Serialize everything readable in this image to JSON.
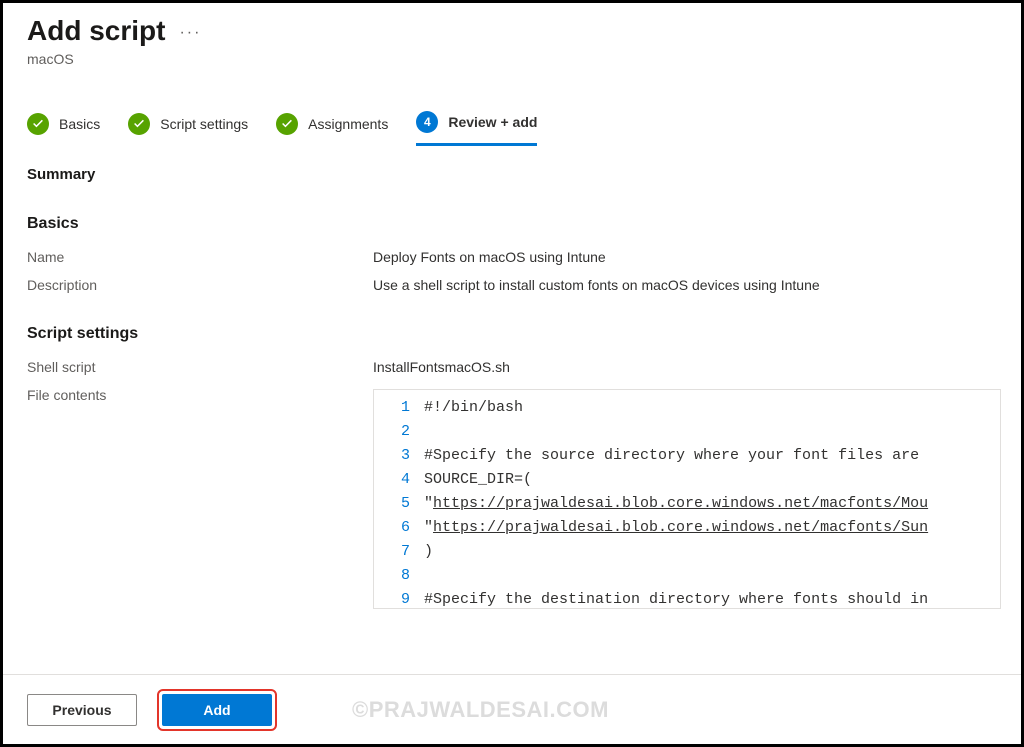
{
  "header": {
    "title": "Add script",
    "subtitle": "macOS",
    "ellipsis": "···"
  },
  "tabs": [
    {
      "label": "Basics",
      "done": true
    },
    {
      "label": "Script settings",
      "done": true
    },
    {
      "label": "Assignments",
      "done": true
    },
    {
      "label": "Review + add",
      "number": "4",
      "active": true
    }
  ],
  "summary_label": "Summary",
  "sections": {
    "basics": {
      "heading": "Basics",
      "rows": [
        {
          "key": "Name",
          "value": "Deploy Fonts on macOS using Intune"
        },
        {
          "key": "Description",
          "value": "Use a shell script to install custom fonts on macOS devices using Intune"
        }
      ]
    },
    "script": {
      "heading": "Script settings",
      "shell_script_key": "Shell script",
      "shell_script_value": "InstallFontsmacOS.sh",
      "file_contents_key": "File contents",
      "code_lines": [
        "#!/bin/bash",
        "",
        "#Specify the source directory where your font files are ",
        "SOURCE_DIR=(",
        "\"https://prajwaldesai.blob.core.windows.net/macfonts/Mou",
        "\"https://prajwaldesai.blob.core.windows.net/macfonts/Sun",
        ")",
        "",
        "#Specify the destination directory where fonts should in"
      ]
    }
  },
  "footer": {
    "previous": "Previous",
    "add": "Add"
  },
  "watermark": "©PRAJWALDESAI.COM"
}
